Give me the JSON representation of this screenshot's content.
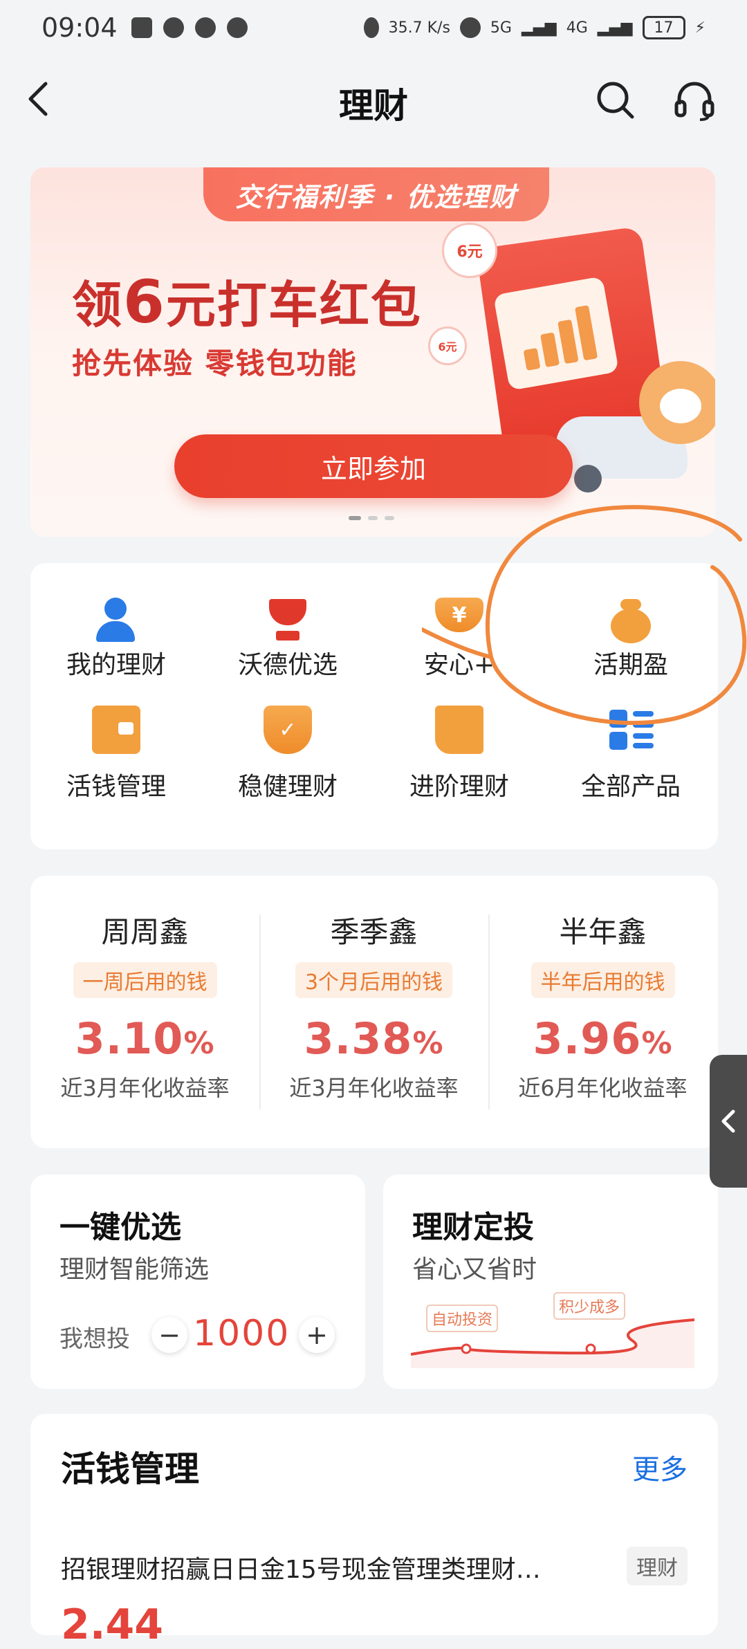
{
  "status_bar": {
    "time": "09:04",
    "network_speed": "35.7 K/s",
    "network_types": [
      "5G",
      "4G"
    ],
    "battery": "17"
  },
  "header": {
    "title": "理财",
    "icons": [
      "back-icon",
      "search-icon",
      "headset-icon"
    ]
  },
  "banner": {
    "tab_text": "交行福利季 · 优选理财",
    "headline_prefix": "领",
    "headline_amount": "6",
    "headline_suffix": "元打车红包",
    "subline": "抢先体验 零钱包功能",
    "button": "立即参加",
    "coin_labels": [
      "6元",
      "6元"
    ],
    "pager_count": 3,
    "pager_active": 1
  },
  "quick_grid": [
    {
      "label": "我的理财",
      "icon": "person-icon"
    },
    {
      "label": "沃德优选",
      "icon": "trophy-icon"
    },
    {
      "label": "安心+",
      "icon": "shield-yuan-icon",
      "icon_text": "¥"
    },
    {
      "label": "活期盈",
      "icon": "money-bag-icon"
    },
    {
      "label": "活钱管理",
      "icon": "wallet-icon"
    },
    {
      "label": "稳健理财",
      "icon": "shield-check-icon"
    },
    {
      "label": "进阶理财",
      "icon": "trend-chart-icon"
    },
    {
      "label": "全部产品",
      "icon": "apps-list-icon"
    }
  ],
  "products": [
    {
      "name": "周周鑫",
      "tag": "一周后用的钱",
      "rate": "3.10",
      "unit": "%",
      "desc": "近3月年化收益率"
    },
    {
      "name": "季季鑫",
      "tag": "3个月后用的钱",
      "rate": "3.38",
      "unit": "%",
      "desc": "近3月年化收益率"
    },
    {
      "name": "半年鑫",
      "tag": "半年后用的钱",
      "rate": "3.96",
      "unit": "%",
      "desc": "近6月年化收益率"
    }
  ],
  "quick_pick": {
    "title": "一键优选",
    "subtitle": "理财智能筛选",
    "invest_label": "我想投",
    "minus": "−",
    "amount": "1000",
    "plus": "+"
  },
  "auto_invest": {
    "title": "理财定投",
    "subtitle": "省心又省时",
    "tags": [
      "自动投资",
      "积少成多"
    ]
  },
  "money_mgmt": {
    "title": "活钱管理",
    "more": "更多",
    "item_name": "招银理财招赢日日金15号现金管理类理财…",
    "item_tag": "理财",
    "item_value_partial": "2.44"
  },
  "colors": {
    "accent_red": "#e4443b",
    "brand_orange": "#f2a03e",
    "link_blue": "#1a6fe0",
    "annotation": "#f0883e"
  }
}
